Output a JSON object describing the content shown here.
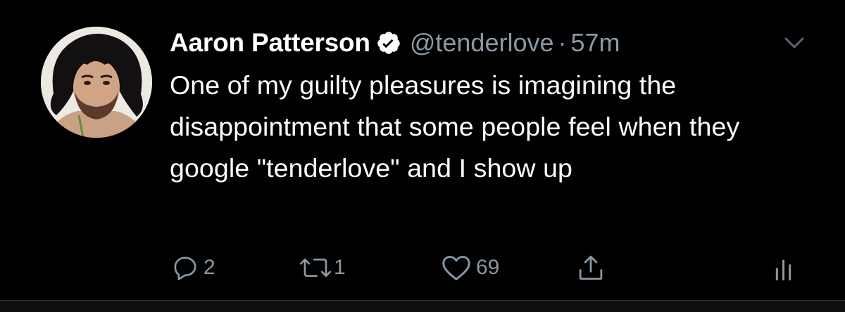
{
  "tweet": {
    "author_name": "Aaron Patterson",
    "handle": "@tenderlove",
    "separator": "·",
    "time": "57m",
    "text": "One of my guilty pleasures is imagining the disappointment that some people feel when they google \"tenderlove\" and I show up",
    "verified": true
  },
  "actions": {
    "reply_count": "2",
    "retweet_count": "1",
    "like_count": "69"
  },
  "icons": {
    "avatar": "profile-photo",
    "verified": "verified-badge-icon",
    "caret": "chevron-down-icon",
    "reply": "reply-icon",
    "retweet": "retweet-icon",
    "like": "heart-icon",
    "share": "share-icon",
    "analytics": "analytics-icon"
  },
  "colors": {
    "background": "#000000",
    "text_primary": "#ffffff",
    "text_secondary": "#8b98a5"
  }
}
